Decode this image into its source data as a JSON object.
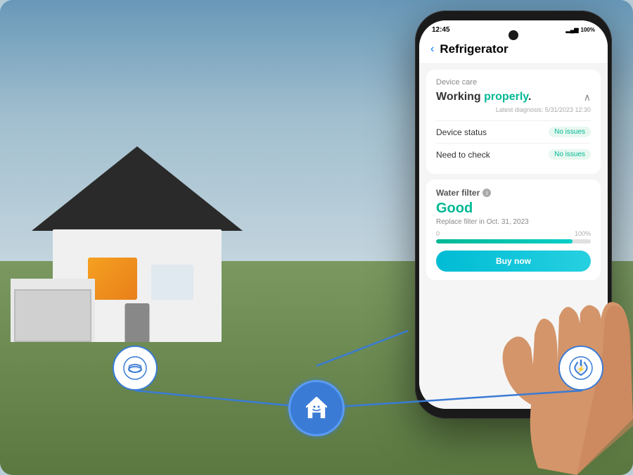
{
  "scene": {
    "bg_color_start": "#6898b8",
    "bg_color_end": "#5a7840"
  },
  "phone": {
    "status_bar": {
      "time": "12:45",
      "signal": "▂▄▆",
      "battery": "100%"
    },
    "header": {
      "back_label": "‹",
      "title": "Refrigerator"
    },
    "device_care": {
      "section_label": "Device care",
      "working_prefix": "Working ",
      "working_status": "properly",
      "working_suffix": ".",
      "chevron": "∧",
      "diagnosis_date": "Latest diagnosis: 5/31/2023 12:30",
      "device_status_label": "Device status",
      "device_status_badge": "No issues",
      "need_to_check_label": "Need to check",
      "need_to_check_badge": "No issues"
    },
    "water_filter": {
      "section_label": "Water filter",
      "status": "Good",
      "replace_text": "Replace filter in Oct. 31, 2023",
      "progress_min": "0",
      "progress_max": "100%",
      "progress_value": 88,
      "buy_button": "Buy now"
    }
  },
  "icons": {
    "center_icon": "🏠",
    "left_icon": "🍵",
    "right_icon": "⚡"
  }
}
